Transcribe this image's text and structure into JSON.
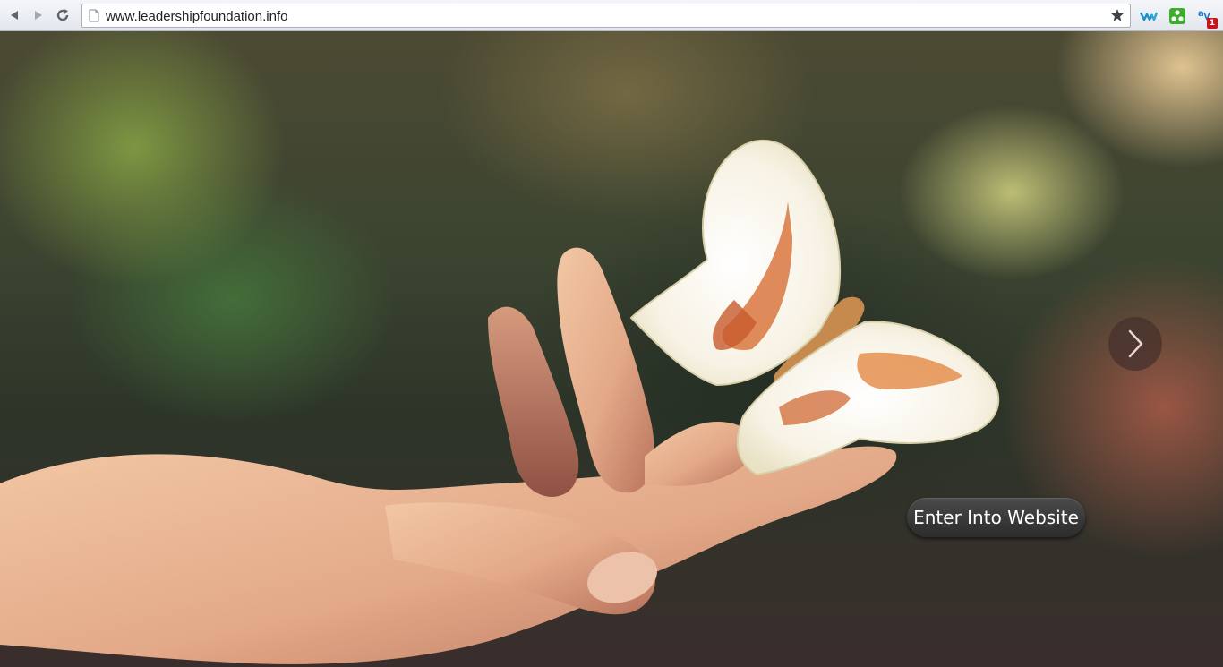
{
  "browser": {
    "url": "www.leadershipfoundation.info",
    "extension_badge": "1"
  },
  "icons": {
    "back": "back-arrow-icon",
    "forward": "forward-arrow-icon",
    "reload": "reload-icon",
    "page": "page-icon",
    "bookmark": "star-icon",
    "extensions": [
      "wave-extension-icon",
      "green-extension-icon",
      "translate-extension-icon"
    ],
    "slider_next": "chevron-right-icon"
  },
  "hero": {
    "image": "hand-with-butterfly-photo",
    "enter_label": "Enter Into Website"
  },
  "colors": {
    "button_bg": "#333333",
    "next_bg": "#46322d",
    "badge": "#c4161c"
  }
}
